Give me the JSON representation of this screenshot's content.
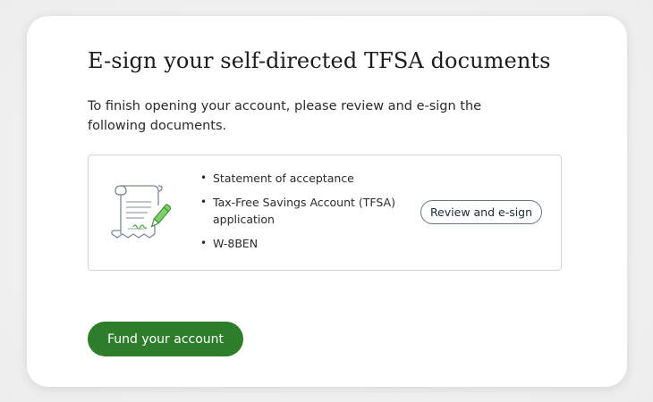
{
  "card": {
    "title": "E-sign your self-directed TFSA documents",
    "description": "To finish opening your account, please review and e-sign the following documents."
  },
  "documents": {
    "illustration_icon": "signed-document-with-pen-icon",
    "items": [
      {
        "label": "Statement of acceptance"
      },
      {
        "label": "Tax-Free Savings Account (TFSA) application"
      },
      {
        "label": "W-8BEN"
      }
    ],
    "review_button_label": "Review and e-sign"
  },
  "actions": {
    "fund_button_label": "Fund your account"
  },
  "colors": {
    "primary_green": "#2d7d2a",
    "accent_green": "#4caf3a",
    "border": "#cfd6dd",
    "outline_button": "#6a7480",
    "background": "#efefef",
    "card": "#ffffff"
  }
}
